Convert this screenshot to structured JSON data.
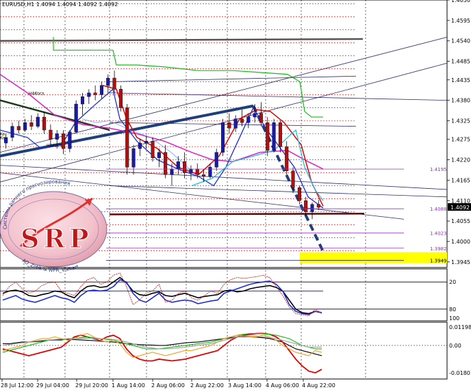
{
  "chart_data": [
    {
      "type": "candlestick",
      "title": "EURUSD,H1  1.4094 1.4094 1.4092 1.4092",
      "symbol": "EURUSD,H1",
      "ohlc_header": [
        "1.4094",
        "1.4094",
        "1.4092",
        "1.4092"
      ],
      "current_price": "1.4092",
      "ylim": [
        1.393,
        1.465
      ],
      "y_ticks": [
        "1.4650",
        "1.4595",
        "1.4540",
        "1.4485",
        "1.4435",
        "1.4380",
        "1.4325",
        "1.4275",
        "1.4220",
        "1.4165",
        "1.4110",
        "1.4055",
        "1.4000",
        "1.3945"
      ],
      "level_labels": [
        {
          "text": "1.4195",
          "price": 1.4195,
          "color": "#9a30c8"
        },
        {
          "text": "1.4088",
          "price": 1.4088,
          "color": "#9a30c8"
        },
        {
          "text": "1.4023",
          "price": 1.4023,
          "color": "#9a30c8"
        },
        {
          "text": "1.3982",
          "price": 1.3982,
          "color": "#9a30c8"
        },
        {
          "text": "1.3949",
          "price": 1.3949,
          "color": "#000000",
          "highlight": "#ffff00"
        }
      ],
      "x_ticks": [
        "28 Jul 12:00",
        "29 Jul 04:00",
        "29 Jul 20:00",
        "1 Aug 14:00",
        "2 Aug 06:00",
        "2 Aug 22:00",
        "3 Aug 14:00",
        "4 Aug 06:00",
        "4 Aug 22:00"
      ],
      "annotations": [
        "HAKocs",
        "HAKocs",
        "Ko",
        "Ko"
      ],
      "grid": true,
      "colors": {
        "bull": "#1a1aa8",
        "bear": "#b01010",
        "wick": "#000000",
        "resistance": "#cc0000",
        "trendline": "#1f3f7a",
        "ma_red": "#e00000",
        "ma_blue": "#1c2cd8",
        "ma_magenta": "#e020c8",
        "ma_green": "#10c010",
        "ma_cyan": "#20c0e0",
        "level_purple": "#9a30c8"
      },
      "candles": [
        [
          1.4265,
          1.429,
          1.425,
          1.428
        ],
        [
          1.428,
          1.432,
          1.427,
          1.431
        ],
        [
          1.431,
          1.4325,
          1.429,
          1.43
        ],
        [
          1.43,
          1.433,
          1.4295,
          1.432
        ],
        [
          1.432,
          1.434,
          1.43,
          1.431
        ],
        [
          1.431,
          1.4345,
          1.4305,
          1.4335
        ],
        [
          1.4335,
          1.435,
          1.429,
          1.43
        ],
        [
          1.43,
          1.4315,
          1.426,
          1.4275
        ],
        [
          1.4275,
          1.43,
          1.425,
          1.429
        ],
        [
          1.429,
          1.43,
          1.4235,
          1.425
        ],
        [
          1.425,
          1.43,
          1.424,
          1.4295
        ],
        [
          1.4295,
          1.438,
          1.429,
          1.437
        ],
        [
          1.437,
          1.44,
          1.434,
          1.439
        ],
        [
          1.439,
          1.441,
          1.437,
          1.44
        ],
        [
          1.44,
          1.442,
          1.438,
          1.4395
        ],
        [
          1.4395,
          1.443,
          1.4385,
          1.442
        ],
        [
          1.442,
          1.445,
          1.44,
          1.444
        ],
        [
          1.444,
          1.446,
          1.44,
          1.441
        ],
        [
          1.441,
          1.442,
          1.435,
          1.436
        ],
        [
          1.436,
          1.437,
          1.418,
          1.42
        ],
        [
          1.42,
          1.426,
          1.418,
          1.425
        ],
        [
          1.425,
          1.4275,
          1.423,
          1.4265
        ],
        [
          1.4265,
          1.4285,
          1.425,
          1.427
        ],
        [
          1.427,
          1.428,
          1.4215,
          1.4225
        ],
        [
          1.4225,
          1.425,
          1.42,
          1.424
        ],
        [
          1.424,
          1.426,
          1.417,
          1.418
        ],
        [
          1.418,
          1.421,
          1.415,
          1.4195
        ],
        [
          1.4195,
          1.423,
          1.418,
          1.4215
        ],
        [
          1.4215,
          1.424,
          1.417,
          1.4185
        ],
        [
          1.4185,
          1.4205,
          1.4165,
          1.4195
        ],
        [
          1.4195,
          1.421,
          1.417,
          1.418
        ],
        [
          1.418,
          1.4195,
          1.416,
          1.4175
        ],
        [
          1.4175,
          1.421,
          1.417,
          1.42
        ],
        [
          1.42,
          1.425,
          1.419,
          1.424
        ],
        [
          1.424,
          1.433,
          1.423,
          1.432
        ],
        [
          1.432,
          1.4345,
          1.429,
          1.4305
        ],
        [
          1.4305,
          1.434,
          1.4295,
          1.433
        ],
        [
          1.433,
          1.4355,
          1.431,
          1.432
        ],
        [
          1.432,
          1.4345,
          1.4305,
          1.4335
        ],
        [
          1.4335,
          1.437,
          1.432,
          1.4345
        ],
        [
          1.4345,
          1.4375,
          1.431,
          1.432
        ],
        [
          1.432,
          1.4335,
          1.423,
          1.4245
        ],
        [
          1.4245,
          1.433,
          1.424,
          1.432
        ],
        [
          1.432,
          1.4325,
          1.424,
          1.4255
        ],
        [
          1.4255,
          1.427,
          1.418,
          1.419
        ],
        [
          1.419,
          1.42,
          1.413,
          1.4145
        ],
        [
          1.4145,
          1.415,
          1.41,
          1.411
        ],
        [
          1.411,
          1.412,
          1.407,
          1.408
        ],
        [
          1.408,
          1.4105,
          1.406,
          1.41
        ],
        [
          1.41,
          1.4112,
          1.4085,
          1.4092
        ]
      ]
    },
    {
      "type": "line",
      "title": "",
      "y_ticks": [
        "20",
        "80",
        "100"
      ],
      "levels": [
        20,
        80
      ],
      "ylim": [
        0,
        100
      ],
      "series": [
        {
          "color": "#000000",
          "values": [
            55,
            60,
            62,
            58,
            50,
            48,
            52,
            55,
            60,
            58,
            50,
            45,
            60,
            70,
            72,
            68,
            70,
            80,
            90,
            78,
            60,
            52,
            50,
            55,
            58,
            50,
            48,
            52,
            55,
            50,
            45,
            48,
            50,
            52,
            60,
            62,
            58,
            60,
            65,
            68,
            70,
            72,
            68,
            60,
            40,
            20,
            12,
            10,
            15,
            12
          ]
        },
        {
          "color": "#1c2cd8",
          "values": [
            40,
            45,
            50,
            42,
            38,
            35,
            40,
            45,
            50,
            45,
            42,
            35,
            50,
            60,
            62,
            60,
            62,
            70,
            85,
            80,
            55,
            40,
            35,
            45,
            55,
            40,
            35,
            38,
            40,
            38,
            32,
            35,
            38,
            40,
            55,
            60,
            65,
            70,
            75,
            78,
            80,
            82,
            75,
            60,
            30,
            15,
            10,
            8,
            15,
            12
          ]
        },
        {
          "color": "#e00000",
          "values": [
            50,
            70,
            80,
            65,
            55,
            60,
            72,
            78,
            80,
            60,
            55,
            50,
            70,
            85,
            90,
            75,
            80,
            95,
            100,
            70,
            30,
            40,
            55,
            60,
            75,
            35,
            40,
            55,
            60,
            45,
            40,
            50,
            60,
            55,
            75,
            85,
            90,
            88,
            90,
            92,
            95,
            90,
            70,
            50,
            25,
            10,
            8,
            5,
            20,
            10
          ]
        }
      ]
    },
    {
      "type": "line",
      "title": "",
      "y_ticks": [
        "0.01198",
        "0.00",
        "-0.01801"
      ],
      "ylim": [
        -0.01801,
        0.01198
      ],
      "series": [
        {
          "color": "#000000",
          "values": [
            0.001,
            0.001,
            0.0015,
            0.002,
            0.002,
            0.0022,
            0.0025,
            0.003,
            0.0032,
            0.0035,
            0.0035,
            0.0034,
            0.0032,
            0.003,
            0.0028,
            0.0025,
            0.0022,
            0.002,
            0.0015,
            0.001,
            0.0008,
            0.0005,
            0.0003,
            0.0002,
            0.0,
            0.0,
            0.0005,
            0.001,
            0.0015,
            0.0018,
            0.002,
            0.0025,
            0.003,
            0.0035,
            0.004,
            0.0045,
            0.005,
            0.0052,
            0.005,
            0.0048,
            0.0045,
            0.004,
            0.003,
            0.002,
            0.0,
            -0.002,
            -0.003,
            -0.004,
            -0.005,
            -0.006
          ]
        },
        {
          "color": "#e00000",
          "values": [
            -0.002,
            -0.003,
            -0.004,
            -0.005,
            -0.006,
            -0.005,
            -0.004,
            -0.003,
            -0.002,
            -0.001,
            0.002,
            0.005,
            0.006,
            0.005,
            0.004,
            0.003,
            0.005,
            0.006,
            0.004,
            -0.002,
            -0.006,
            -0.008,
            -0.009,
            -0.009,
            -0.008,
            -0.0085,
            -0.009,
            -0.0085,
            -0.008,
            -0.007,
            -0.006,
            -0.005,
            -0.004,
            -0.003,
            0.0,
            0.003,
            0.005,
            0.006,
            0.0065,
            0.007,
            0.007,
            0.0065,
            0.005,
            0.002,
            -0.003,
            -0.008,
            -0.012,
            -0.015,
            -0.016,
            -0.014
          ]
        },
        {
          "color": "#10c010",
          "values": [
            -0.004,
            -0.003,
            -0.002,
            -0.001,
            0.0,
            0.001,
            0.002,
            0.003,
            0.003,
            0.003,
            0.004,
            0.004,
            0.0045,
            0.005,
            0.0045,
            0.004,
            0.0035,
            0.003,
            0.002,
            0.001,
            0.0,
            -0.001,
            -0.002,
            -0.002,
            -0.002,
            -0.0015,
            -0.001,
            -0.0005,
            0.0,
            0.0005,
            0.001,
            0.0015,
            0.002,
            0.003,
            0.004,
            0.005,
            0.006,
            0.0065,
            0.007,
            0.007,
            0.0068,
            0.0065,
            0.006,
            0.005,
            0.004,
            0.002,
            0.0,
            -0.001,
            -0.002,
            -0.002
          ]
        },
        {
          "color": "#f0a020",
          "values": [
            -0.003,
            -0.002,
            -0.001,
            0.0,
            0.002,
            0.003,
            0.004,
            0.004,
            0.005,
            0.004,
            0.003,
            0.004,
            0.006,
            0.007,
            0.005,
            0.003,
            0.002,
            0.003,
            0.001,
            -0.004,
            -0.007,
            -0.006,
            -0.005,
            -0.004,
            -0.005,
            -0.006,
            -0.005,
            -0.004,
            -0.003,
            -0.003,
            -0.002,
            -0.001,
            0.0,
            0.002,
            0.004,
            0.005,
            0.006,
            0.0055,
            0.005,
            0.005,
            0.006,
            0.005,
            0.003,
            0.0,
            -0.002,
            -0.004,
            -0.005,
            -0.006,
            -0.003,
            -0.004
          ]
        },
        {
          "color": "#a0a0a0",
          "values": [
            0.0,
            0.0005,
            0.001,
            0.0015,
            0.002,
            0.0025,
            0.003,
            0.0032,
            0.0035,
            0.0038,
            0.004,
            0.004,
            0.004,
            0.0042,
            0.0042,
            0.004,
            0.0038,
            0.0035,
            0.003,
            0.002,
            0.001,
            0.0,
            -0.001,
            -0.0015,
            -0.002,
            -0.002,
            -0.0018,
            -0.0015,
            -0.001,
            -0.0005,
            0.0,
            0.0005,
            0.001,
            0.002,
            0.003,
            0.004,
            0.005,
            0.0055,
            0.0055,
            0.0055,
            0.005,
            0.0045,
            0.004,
            0.003,
            0.002,
            0.001,
            0.0,
            -0.001,
            -0.001,
            -0.001
          ]
        }
      ]
    }
  ],
  "logo": {
    "letters": "SRP",
    "ring_text_top": "Системы раннего прогнозирования",
    "ring_text_bottom": "AO_Zotik & WPR_VSmart"
  }
}
